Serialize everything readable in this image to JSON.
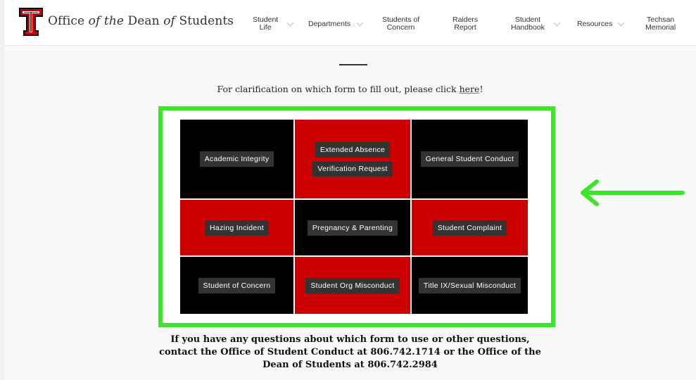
{
  "header": {
    "site_title_pre": "Office ",
    "site_title_of": "of the",
    "site_title_mid": " Dean ",
    "site_title_of2": "of",
    "site_title_post": " Students",
    "nav": [
      {
        "label": "Student\nLife",
        "has_dropdown": true
      },
      {
        "label": "Departments",
        "has_dropdown": true
      },
      {
        "label": "Students of\nConcern",
        "has_dropdown": false
      },
      {
        "label": "Raiders\nReport",
        "has_dropdown": false
      },
      {
        "label": "Student\nHandbook",
        "has_dropdown": true
      },
      {
        "label": "Resources",
        "has_dropdown": true
      },
      {
        "label": "Techsan\nMemorial",
        "has_dropdown": false
      }
    ]
  },
  "main": {
    "clarify_text": "For clarification on which form to fill out, please click ",
    "clarify_link": "here",
    "clarify_end": "!",
    "forms": [
      {
        "labels": [
          "Academic Integrity"
        ],
        "color": "black"
      },
      {
        "labels": [
          "Extended Absence",
          "Verification Request"
        ],
        "color": "red"
      },
      {
        "labels": [
          "General Student Conduct"
        ],
        "color": "black"
      },
      {
        "labels": [
          "Hazing Incident"
        ],
        "color": "red"
      },
      {
        "labels": [
          "Pregnancy & Parenting"
        ],
        "color": "black"
      },
      {
        "labels": [
          "Student Complaint"
        ],
        "color": "red"
      },
      {
        "labels": [
          "Student of Concern"
        ],
        "color": "black"
      },
      {
        "labels": [
          "Student Org Misconduct"
        ],
        "color": "red"
      },
      {
        "labels": [
          "Title IX/Sexual Misconduct"
        ],
        "color": "black"
      }
    ],
    "bottom_note": [
      "If you have any questions about which form to use or other questions,",
      "contact the Office of Student Conduct at 806.742.1714 or the Office of the",
      "Dean of Students at 806.742.2984"
    ]
  },
  "colors": {
    "brand_red": "#cc0000",
    "tile_black": "#000000",
    "highlight_green": "#3be52a"
  },
  "icons": {
    "logo": "texas-tech-double-t-logo",
    "chevron": "chevron-down-icon",
    "arrow": "arrow-left-icon"
  }
}
